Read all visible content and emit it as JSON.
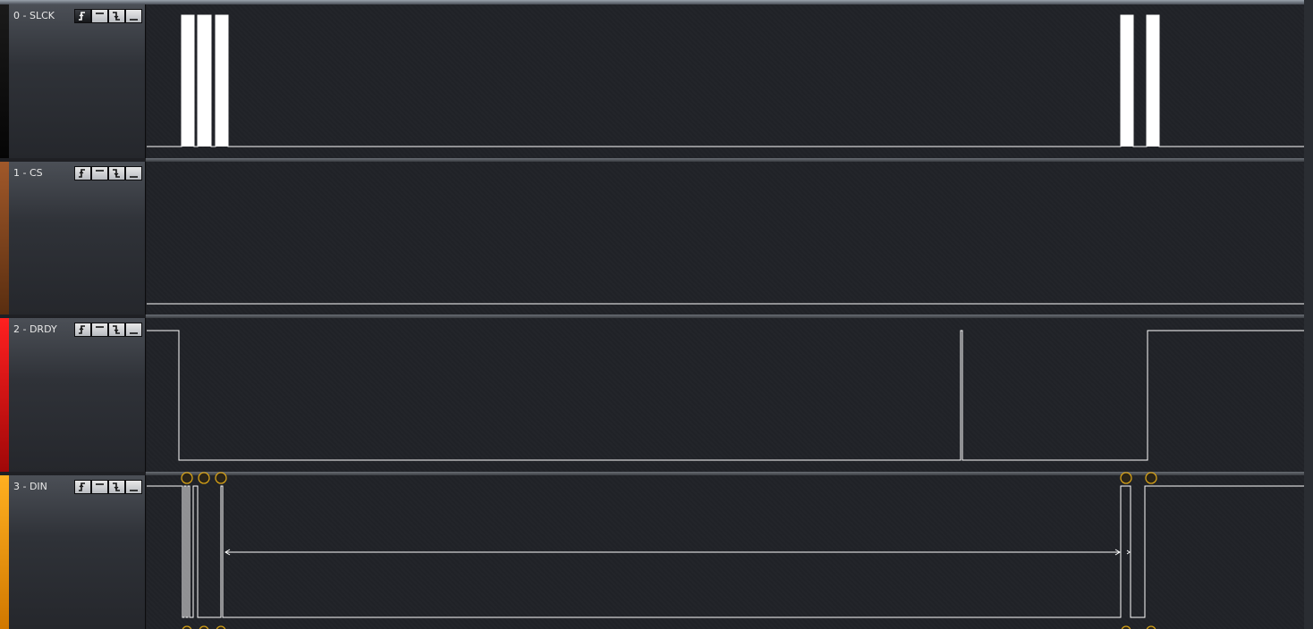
{
  "channels": [
    {
      "name": "0 - SLCK",
      "color": "#111111"
    },
    {
      "name": "1 - CS",
      "color": "#8b4a1e"
    },
    {
      "name": "2 - DRDY",
      "color": "#d41010"
    },
    {
      "name": "3 - DIN",
      "color": "#f0a010"
    }
  ],
  "trigger_buttons": [
    {
      "icon": "rising-edge-icon"
    },
    {
      "icon": "high-level-icon"
    },
    {
      "icon": "falling-edge-icon"
    },
    {
      "icon": "low-level-icon"
    }
  ],
  "colors": {
    "trace": "#ffffff",
    "marker": "#d4a017",
    "background": "#202227"
  }
}
